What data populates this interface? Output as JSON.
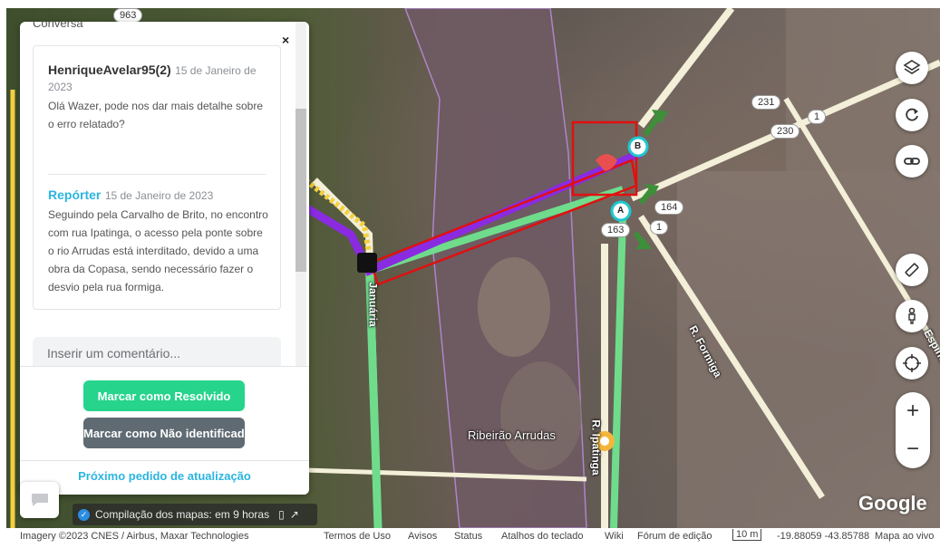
{
  "panel": {
    "tab_title": "Conversa",
    "close_label": "×",
    "comments": [
      {
        "author": "HenriqueAvelar95(2)",
        "date": "15 de Janeiro de 2023",
        "text": "Olá Wazer, pode nos dar mais detalhe sobre o erro relatado?"
      },
      {
        "author": "Repórter",
        "date": "15 de Janeiro de 2023",
        "text": "Seguindo pela Carvalho de Brito, no encontro com rua Ipatinga, o acesso pela ponte sobre o rio Arrudas está interditado, devido a uma obra da Copasa, sendo necessário fazer o desvio pela rua formiga."
      }
    ],
    "comment_placeholder": "Inserir um comentário...",
    "resolved_button": "Marcar como Resolvido",
    "not_identified_button": "Marcar como Não identificado",
    "next_request_link": "Próximo pedido de atualização"
  },
  "map": {
    "river_label": "Ribeirão Arrudas",
    "road_labels": [
      "R. Formiga",
      "R. Ipatinga",
      "Espinosa",
      "Januária"
    ],
    "segment_badges": [
      "963",
      "231",
      "1",
      "230",
      "164",
      "1",
      "163"
    ],
    "node_labels": [
      "A",
      "B"
    ],
    "google_logo": "Google",
    "compile_status": "Compilação dos mapas: em 9 horas"
  },
  "footer": {
    "imagery": "Imagery ©2023 CNES / Airbus, Maxar Technologies",
    "links": [
      "Termos de Uso",
      "Avisos",
      "Status",
      "Atalhos do teclado",
      "Wiki",
      "Fórum de edição"
    ],
    "scale": "10 m",
    "coords": "-19.88059 -43.85788",
    "viewer": "Mapa ao vivo"
  },
  "icons": {
    "layers": "layers-icon",
    "refresh": "refresh-icon",
    "link": "link-icon",
    "ruler": "ruler-icon",
    "street_view": "person-icon",
    "locate": "crosshair-icon",
    "zoom_in": "+",
    "zoom_out": "−"
  },
  "colors": {
    "accent": "#2bb5e0",
    "resolved_green": "#26d48c",
    "gray_button": "#5f6a72",
    "route_purple": "#8a2be2",
    "route_green": "#6fdc8c",
    "highlight_red": "#e01010"
  }
}
